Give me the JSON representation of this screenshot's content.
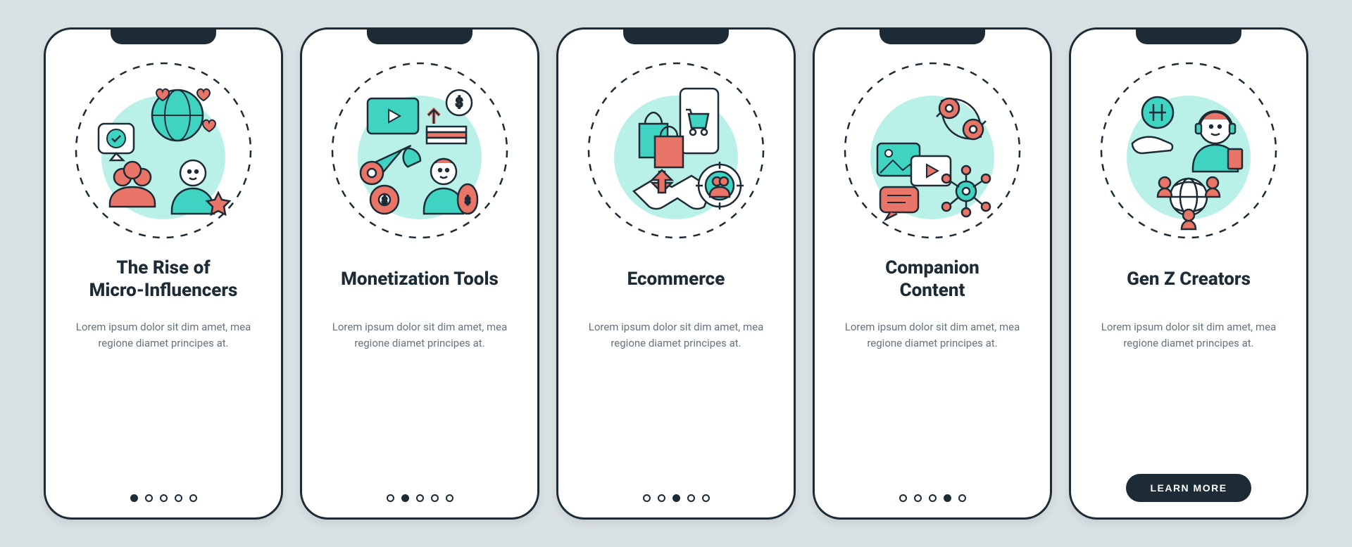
{
  "colors": {
    "accent": "#3fd4c2",
    "coral": "#e87568",
    "dark": "#1d2b36",
    "bg": "#d9e1e4"
  },
  "slides": [
    {
      "title": "The Rise of\nMicro-Influencers",
      "desc": "Lorem ipsum dolor sit dim amet, mea regione diamet principes at.",
      "active_index": 0,
      "show_button": false
    },
    {
      "title": "Monetization Tools",
      "desc": "Lorem ipsum dolor sit dim amet, mea regione diamet principes at.",
      "active_index": 1,
      "show_button": false
    },
    {
      "title": "Ecommerce",
      "desc": "Lorem ipsum dolor sit dim amet, mea regione diamet principes at.",
      "active_index": 2,
      "show_button": false
    },
    {
      "title": "Companion\nContent",
      "desc": "Lorem ipsum dolor sit dim amet, mea regione diamet principes at.",
      "active_index": 3,
      "show_button": false
    },
    {
      "title": "Gen Z Creators",
      "desc": "Lorem ipsum dolor sit dim amet, mea regione diamet principes at.",
      "active_index": 4,
      "show_button": true
    }
  ],
  "button_label": "LEARN MORE",
  "total_dots": 5
}
